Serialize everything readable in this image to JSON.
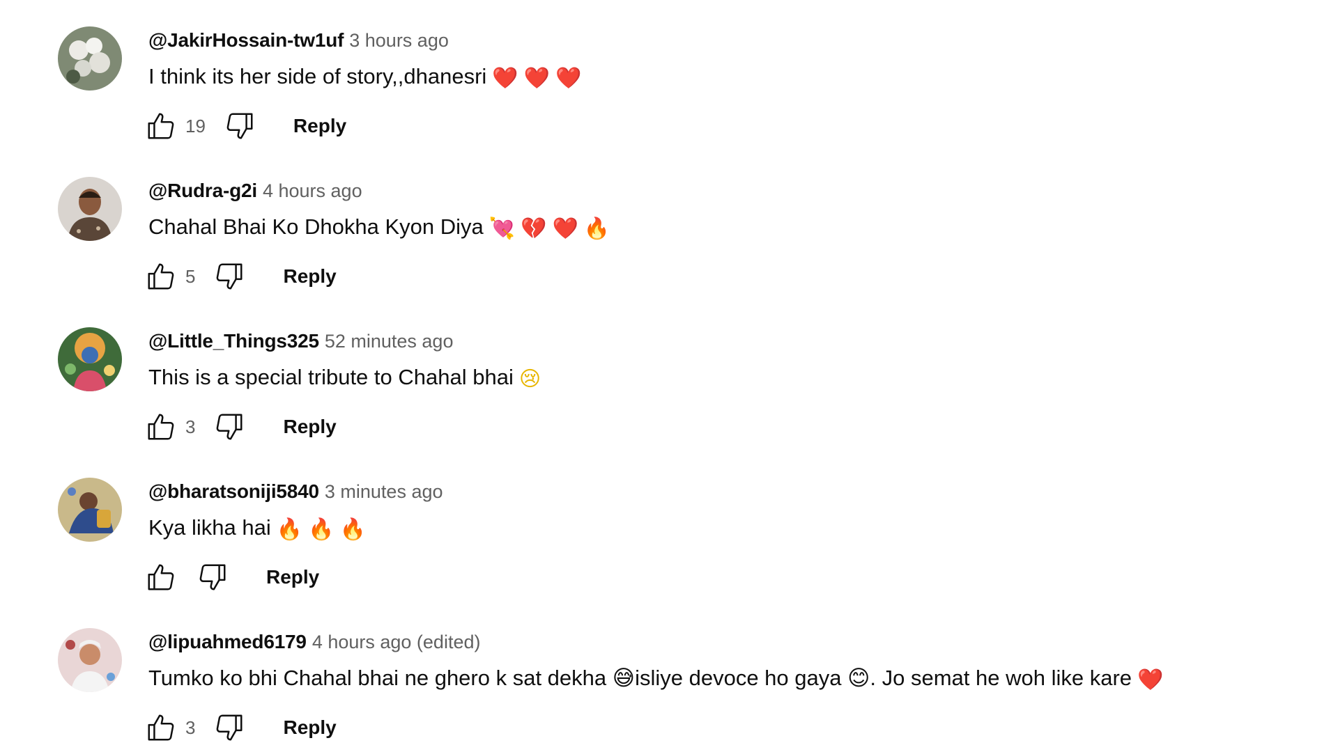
{
  "comments": [
    {
      "author": "@JakirHossain-tw1uf",
      "time": "3 hours ago",
      "text": "I think its her side of story,,dhanesri",
      "emoji": [
        "❤️",
        "❤️",
        "❤️"
      ],
      "likes": "19",
      "reply_label": "Reply",
      "avatar": {
        "bg": "#7f8a74",
        "fg": "#e6e6e0"
      }
    },
    {
      "author": "@Rudra-g2i",
      "time": "4 hours ago",
      "text": "Chahal Bhai Ko Dhokha Kyon Diya",
      "emoji": [
        "💘",
        "💔",
        "❤️",
        "🔥"
      ],
      "likes": "5",
      "reply_label": "Reply",
      "avatar": {
        "bg": "#d9d4cf",
        "fg": "#4a3a2e"
      }
    },
    {
      "author": "@Little_Things325",
      "time": "52 minutes ago",
      "text": "This is a special tribute to Chahal bhai",
      "emoji": [
        "😢"
      ],
      "likes": "3",
      "reply_label": "Reply",
      "avatar": {
        "bg": "#3f6b3a",
        "fg": "#e7a343"
      }
    },
    {
      "author": "@bharatsoniji5840",
      "time": "3 minutes ago",
      "text": "Kya likha hai",
      "emoji": [
        "🔥",
        "🔥",
        "🔥"
      ],
      "likes": "",
      "reply_label": "Reply",
      "avatar": {
        "bg": "#c9b98a",
        "fg": "#2e4c8c"
      }
    },
    {
      "author": "@lipuahmed6179",
      "time": "4 hours ago (edited)",
      "text": "Tumko ko bhi Chahal bhai ne ghero k sat dekha 😅isliye devoce ho gaya 😊. Jo semat he woh like kare",
      "emoji": [
        "❤️"
      ],
      "likes": "3",
      "reply_label": "Reply",
      "avatar": {
        "bg": "#e9d6d6",
        "fg": "#b24a4a"
      }
    }
  ]
}
